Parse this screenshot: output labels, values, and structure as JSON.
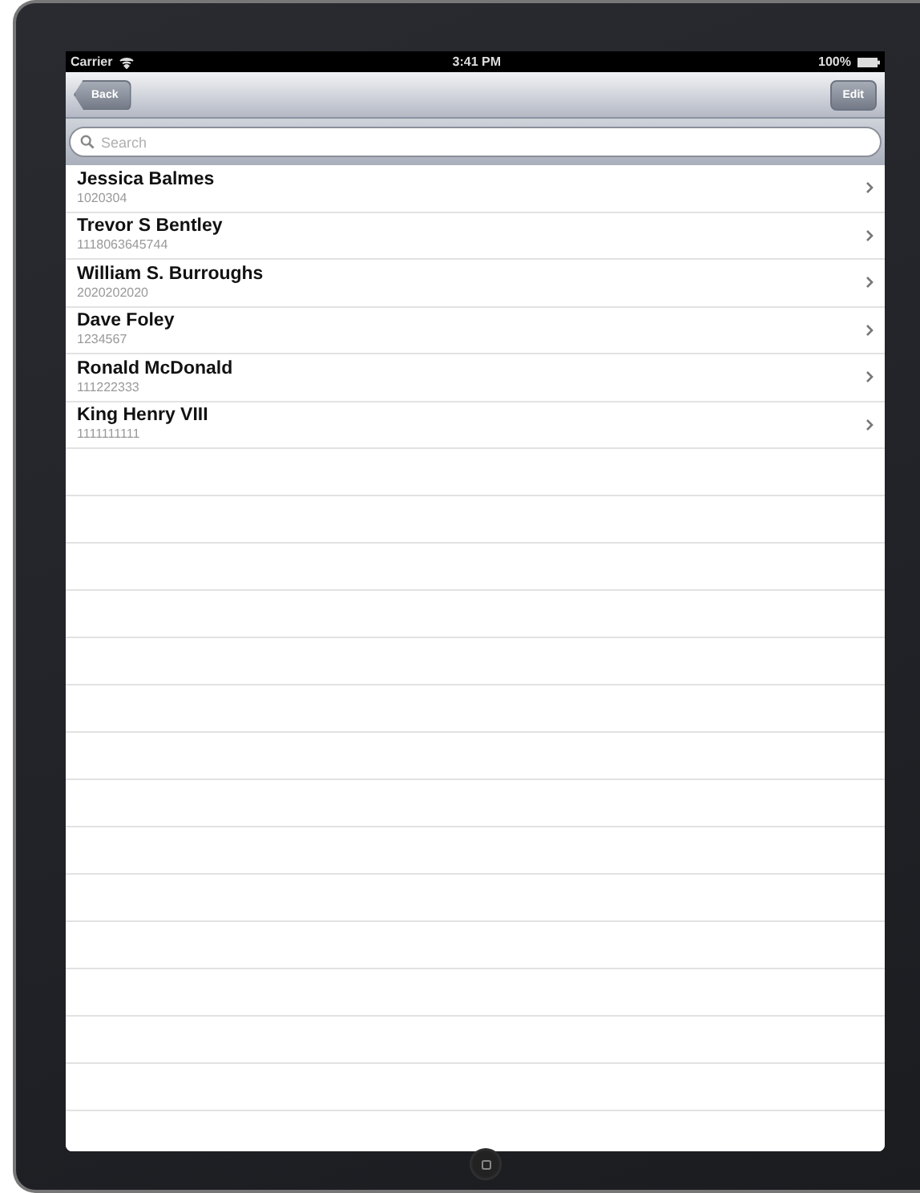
{
  "status_bar": {
    "carrier": "Carrier",
    "time": "3:41 PM",
    "battery": "100%"
  },
  "nav_bar": {
    "back": "Back",
    "edit": "Edit"
  },
  "search": {
    "placeholder": "Search"
  },
  "rows": [
    {
      "name": "Jessica Balmes",
      "number": "1020304"
    },
    {
      "name": "Trevor S Bentley",
      "number": "1118063645744"
    },
    {
      "name": "William S. Burroughs",
      "number": "2020202020"
    },
    {
      "name": "Dave Foley",
      "number": "1234567"
    },
    {
      "name": "Ronald McDonald",
      "number": "111222333"
    },
    {
      "name": "King Henry VIII",
      "number": "1111111111"
    }
  ]
}
